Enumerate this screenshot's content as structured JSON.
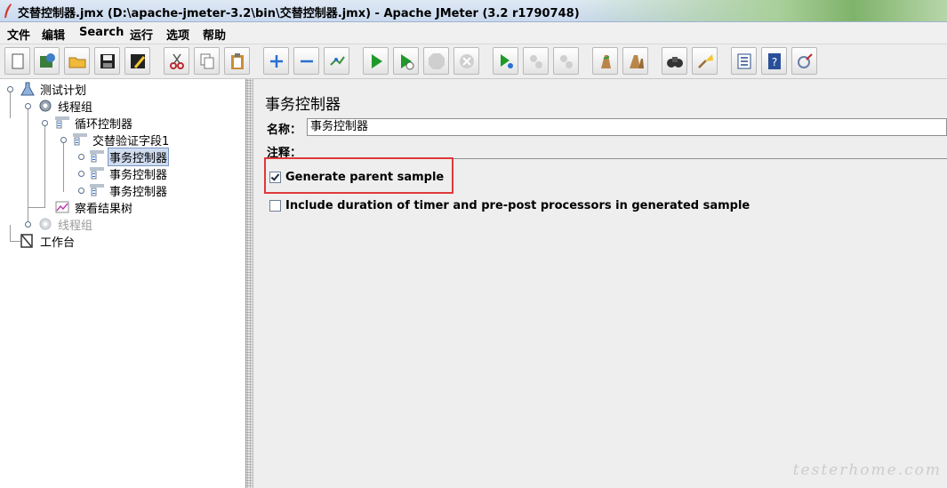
{
  "window": {
    "title": "交替控制器.jmx (D:\\apache-jmeter-3.2\\bin\\交替控制器.jmx) - Apache JMeter (3.2 r1790748)"
  },
  "menu": {
    "items": [
      "文件",
      "编辑",
      "Search",
      "运行",
      "选项",
      "帮助"
    ]
  },
  "toolbar": {
    "buttons": [
      {
        "icon": "new-icon"
      },
      {
        "icon": "templates-icon"
      },
      {
        "icon": "open-icon"
      },
      {
        "icon": "save-icon"
      },
      {
        "icon": "save-as-icon"
      },
      {
        "icon": "cut-icon"
      },
      {
        "icon": "copy-icon"
      },
      {
        "icon": "paste-icon"
      },
      {
        "icon": "expand-icon"
      },
      {
        "icon": "collapse-icon"
      },
      {
        "icon": "toggle-icon"
      },
      {
        "icon": "start-icon"
      },
      {
        "icon": "start-no-pause-icon"
      },
      {
        "icon": "stop-icon"
      },
      {
        "icon": "shutdown-icon"
      },
      {
        "icon": "remote-start-icon"
      },
      {
        "icon": "remote-stop-icon"
      },
      {
        "icon": "remote-shutdown-icon"
      },
      {
        "icon": "clear-icon"
      },
      {
        "icon": "clear-all-icon"
      },
      {
        "icon": "search-icon"
      },
      {
        "icon": "reset-search-icon"
      },
      {
        "icon": "function-helper-icon"
      },
      {
        "icon": "help-icon"
      },
      {
        "icon": "log-viewer-icon"
      }
    ]
  },
  "tree": {
    "nodes": [
      {
        "label": "测试计划",
        "icon": "test-plan-icon",
        "state": "normal"
      },
      {
        "label": "线程组",
        "icon": "thread-group-icon",
        "state": "normal"
      },
      {
        "label": "循环控制器",
        "icon": "controller-icon",
        "state": "normal"
      },
      {
        "label": "交替验证字段1",
        "icon": "controller-icon",
        "state": "normal"
      },
      {
        "label": "事务控制器",
        "icon": "controller-icon",
        "state": "selected"
      },
      {
        "label": "事务控制器",
        "icon": "controller-icon",
        "state": "normal"
      },
      {
        "label": "事务控制器",
        "icon": "controller-icon",
        "state": "normal"
      },
      {
        "label": "察看结果树",
        "icon": "listener-icon",
        "state": "normal"
      },
      {
        "label": "线程组",
        "icon": "thread-group-icon",
        "state": "disabled"
      },
      {
        "label": "工作台",
        "icon": "workbench-icon",
        "state": "normal"
      }
    ]
  },
  "editor": {
    "title": "事务控制器",
    "name_label": "名称：",
    "name_value": "事务控制器",
    "comment_label": "注释：",
    "comment_value": "",
    "generate_parent_sample": {
      "label": "Generate parent sample",
      "checked": true
    },
    "include_timer_duration": {
      "label": "Include duration of timer and pre-post processors in generated sample",
      "checked": false
    }
  },
  "watermark": "testerhome.com",
  "colors": {
    "highlight": "#e0383a",
    "selection": "#cfdcf0"
  }
}
